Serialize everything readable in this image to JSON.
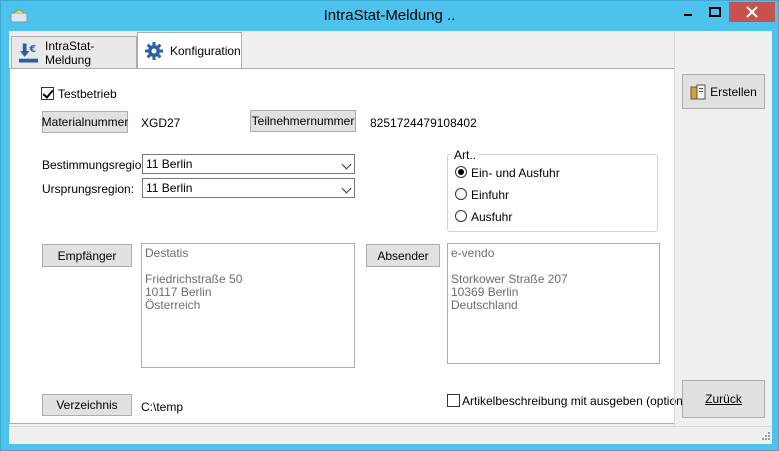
{
  "window": {
    "title": "IntraStat-Meldung .."
  },
  "tabs": [
    {
      "label": "IntraStat-Meldung",
      "icon": "euro-download-icon",
      "active": false
    },
    {
      "label": "Konfiguration",
      "icon": "gear-icon",
      "active": true
    }
  ],
  "form": {
    "testbetrieb_label": "Testbetrieb",
    "testbetrieb_checked": true,
    "materialnummer_button": "Materialnummer",
    "materialnummer_value": "XGD27",
    "teilnehmernummer_button": "Teilnehmernummer",
    "teilnehmernummer_value": "8251724479108402",
    "bestimmungsregion_label": "Bestimmungsregion:",
    "bestimmungsregion_value": "11 Berlin",
    "ursprungsregion_label": "Ursprungsregion:",
    "ursprungsregion_value": "11 Berlin",
    "art": {
      "title": "Art..",
      "options": [
        "Ein- und Ausfuhr",
        "Einfuhr",
        "Ausfuhr"
      ],
      "selected_index": 0
    },
    "empfaenger_button": "Empfänger",
    "empfaenger_address": "Destatis\n\nFriedrichstraße 50\n10117 Berlin\nÖsterreich",
    "absender_button": "Absender",
    "absender_address": "e-vendo\n\nStorkower Straße 207\n10369 Berlin\nDeutschland",
    "verzeichnis_button": "Verzeichnis",
    "verzeichnis_value": "C:\\temp",
    "artikelbeschreibung_label": "Artikelbeschreibung mit ausgeben (optional)",
    "artikelbeschreibung_checked": false
  },
  "sidebar": {
    "erstellen_button": "Erstellen",
    "zurueck_button": "Zurück"
  },
  "colors": {
    "titlebar": "#4dc2ec",
    "close_button": "#c75050"
  }
}
